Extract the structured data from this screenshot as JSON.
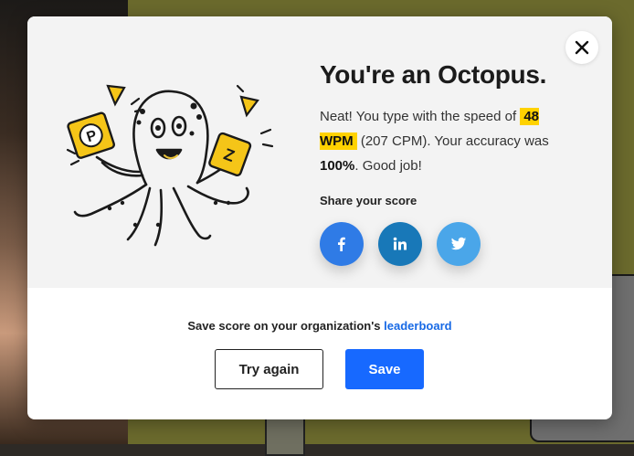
{
  "modal": {
    "title": "You're an Octopus.",
    "text_prefix": "Neat! You type with the speed of",
    "wpm": "48 WPM",
    "cpm_text": "(207 CPM). Your accuracy was",
    "accuracy": "100%",
    "text_suffix": ". Good job!",
    "share_label": "Share your score",
    "save_note_prefix": "Save score on your organization's",
    "save_note_link": "leaderboard",
    "try_again_label": "Try again",
    "save_label": "Save"
  },
  "illustration": {
    "left_badge_letter": "P",
    "right_badge_letter": "Z"
  },
  "social": [
    {
      "name": "facebook",
      "icon": "facebook-icon",
      "color": "#2f7be6"
    },
    {
      "name": "linkedin",
      "icon": "linkedin-icon",
      "color": "#1878b8"
    },
    {
      "name": "twitter",
      "icon": "twitter-icon",
      "color": "#4aa6e9"
    }
  ],
  "colors": {
    "highlight": "#ffd200",
    "primary": "#1769ff",
    "link": "#1769e5"
  }
}
